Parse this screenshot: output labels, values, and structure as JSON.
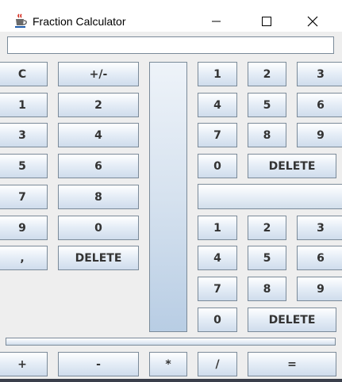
{
  "window": {
    "title": "Fraction Calculator",
    "icon": "java-cup-icon",
    "controls": [
      "minimize-icon",
      "maximize-icon",
      "close-icon"
    ]
  },
  "display": {
    "value": ""
  },
  "left_keypad": {
    "clear": "C",
    "sign": "+/-",
    "k1": "1",
    "k2": "2",
    "k3": "3",
    "k4": "4",
    "k5": "5",
    "k6": "6",
    "k7": "7",
    "k8": "8",
    "k9": "9",
    "k0": "0",
    "comma": ",",
    "delete": "DELETE"
  },
  "right_top_keypad": {
    "k1": "1",
    "k2": "2",
    "k3": "3",
    "k4": "4",
    "k5": "5",
    "k6": "6",
    "k7": "7",
    "k8": "8",
    "k9": "9",
    "k0": "0",
    "delete": "DELETE"
  },
  "right_bottom_keypad": {
    "k1": "1",
    "k2": "2",
    "k3": "3",
    "k4": "4",
    "k5": "5",
    "k6": "6",
    "k7": "7",
    "k8": "8",
    "k9": "9",
    "k0": "0",
    "delete": "DELETE"
  },
  "operators": {
    "plus": "+",
    "minus": "-",
    "multiply": "*",
    "divide": "/",
    "equals": "="
  }
}
